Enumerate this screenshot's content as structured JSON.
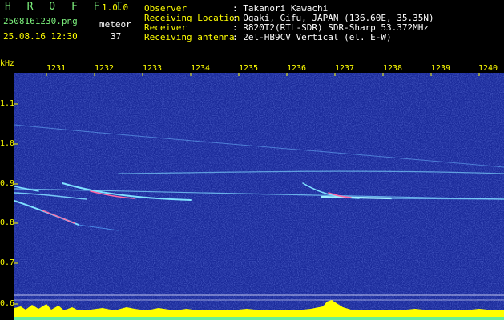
{
  "header": {
    "app_name": "H R O F F T",
    "version": "1.0.0",
    "filename": "2508161230.png",
    "meteor_label": "meteor",
    "datetime": "25.08.16 12:30",
    "meteor_count": "37",
    "fields": [
      {
        "label": "Observer",
        "value": ": Takanori Kawachi"
      },
      {
        "label": "Receiving Location",
        "value": ": Ogaki, Gifu, JAPAN (136.60E, 35.35N)"
      },
      {
        "label": "Receiver",
        "value": ": R820T2(RTL-SDR) SDR-Sharp 53.372MHz"
      },
      {
        "label": "Receiving antenna",
        "value": ": 2el-HB9CV Vertical (el. E-W)"
      }
    ]
  },
  "axes": {
    "y_unit": "kHz",
    "y_ticks": [
      "1.1",
      "1.0",
      "0.9",
      "0.8",
      "0.7",
      "0.6"
    ],
    "x_ticks": [
      "1231",
      "1232",
      "1233",
      "1234",
      "1235",
      "1236",
      "1237",
      "1238",
      "1239",
      "1240"
    ]
  },
  "colors": {
    "background_blue": "#1a2a9a",
    "trace_cyan": "#7fd8ff",
    "axis_yellow": "#ffff00",
    "header_green": "#7cf07c",
    "level_bar_yellow": "#ffff00",
    "level_bar_cyan": "#00e5ff"
  }
}
